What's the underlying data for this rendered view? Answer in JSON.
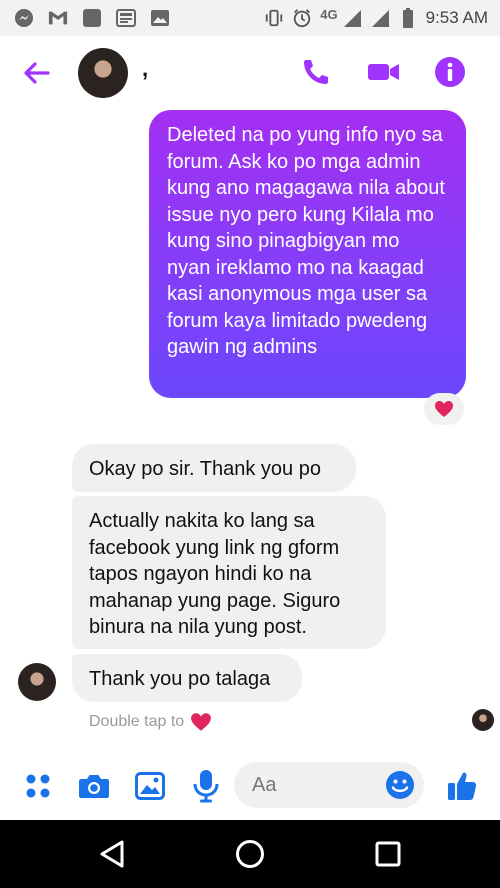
{
  "status_bar": {
    "network": "4G",
    "time": "9:53 AM",
    "icons": [
      "messenger-icon",
      "gmail-icon",
      "square-app-icon",
      "news-icon",
      "gallery-icon",
      "vibrate-icon",
      "alarm-icon",
      "signal-icon",
      "signal-icon",
      "battery-icon"
    ]
  },
  "header": {
    "contact_name": ",",
    "icons": [
      "back-arrow-icon",
      "phone-icon",
      "video-icon",
      "info-icon"
    ]
  },
  "messages": {
    "sent_1": "Deleted na po yung info nyo sa forum. Ask ko po mga admin kung ano magagawa nila about issue nyo pero kung Kilala mo kung sino pinagbigyan mo nyan ireklamo mo na kaagad kasi anonymous mga user sa forum kaya limitado pwedeng gawin ng admins",
    "sent_1_reaction": "heart",
    "received_1": "Okay po sir. Thank you po",
    "received_2": "Actually nakita ko lang sa facebook yung link ng gform tapos ngayon hindi ko na mahanap yung page. Siguro binura na nila yung post.",
    "received_3": "Thank you po talaga",
    "double_tap_hint": "Double tap to"
  },
  "composer": {
    "placeholder": "Aa",
    "icons": [
      "menu-dots-icon",
      "camera-icon",
      "image-icon",
      "microphone-icon",
      "emoji-icon",
      "thumbs-up-icon"
    ]
  },
  "nav_bar": {
    "icons": [
      "back-triangle-icon",
      "home-circle-icon",
      "recents-square-icon"
    ]
  },
  "colors": {
    "accent": "#a033ff",
    "blue": "#1a73e8",
    "sent_gradient_top": "#a42ff2",
    "sent_gradient_bottom": "#6c47fb",
    "received_bg": "#f0f0f0",
    "heart": "#e0245e"
  }
}
